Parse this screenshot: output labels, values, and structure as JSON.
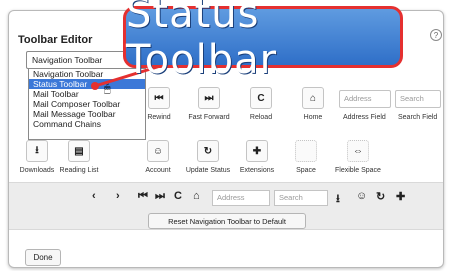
{
  "callout": {
    "text": "Status Toolbar"
  },
  "dialog": {
    "title": "Toolbar Editor",
    "help_icon": "?",
    "select": {
      "value": "Navigation Toolbar",
      "arrow": "▼"
    },
    "options": [
      {
        "label": "Navigation Toolbar",
        "selected": false
      },
      {
        "label": "Status Toolbar",
        "selected": true
      },
      {
        "label": "Mail Toolbar",
        "selected": false
      },
      {
        "label": "Mail Composer Toolbar",
        "selected": false
      },
      {
        "label": "Mail Message Toolbar",
        "selected": false
      },
      {
        "label": "Command Chains",
        "selected": false
      }
    ]
  },
  "palette": {
    "row1": [
      {
        "label": "Rewind",
        "icon": "⏮"
      },
      {
        "label": "Fast Forward",
        "icon": "⏭"
      },
      {
        "label": "Reload",
        "icon": "C"
      },
      {
        "label": "Home",
        "icon": "⌂"
      }
    ],
    "address_field": {
      "placeholder": "Address",
      "label": "Address Field"
    },
    "search_field": {
      "placeholder": "Search",
      "label": "Search Field"
    },
    "row2": [
      {
        "label": "Downloads",
        "icon": "⭳"
      },
      {
        "label": "Reading List",
        "icon": "▤"
      },
      {
        "label": "Account",
        "icon": "☺"
      },
      {
        "label": "Update Status",
        "icon": "↻"
      },
      {
        "label": "Extensions",
        "icon": "✚"
      },
      {
        "label": "Space",
        "icon": ""
      },
      {
        "label": "Flexible Space",
        "icon": "⇔"
      }
    ]
  },
  "preview": {
    "icons": [
      "‹",
      "›",
      "⏮",
      "⏭",
      "C",
      "⌂"
    ],
    "address": "Address",
    "search": "Search",
    "icons_right": [
      "⭳",
      "☺",
      "↻",
      "✚"
    ],
    "reset_label": "Reset Navigation Toolbar to Default"
  },
  "footer": {
    "done_label": "Done"
  }
}
